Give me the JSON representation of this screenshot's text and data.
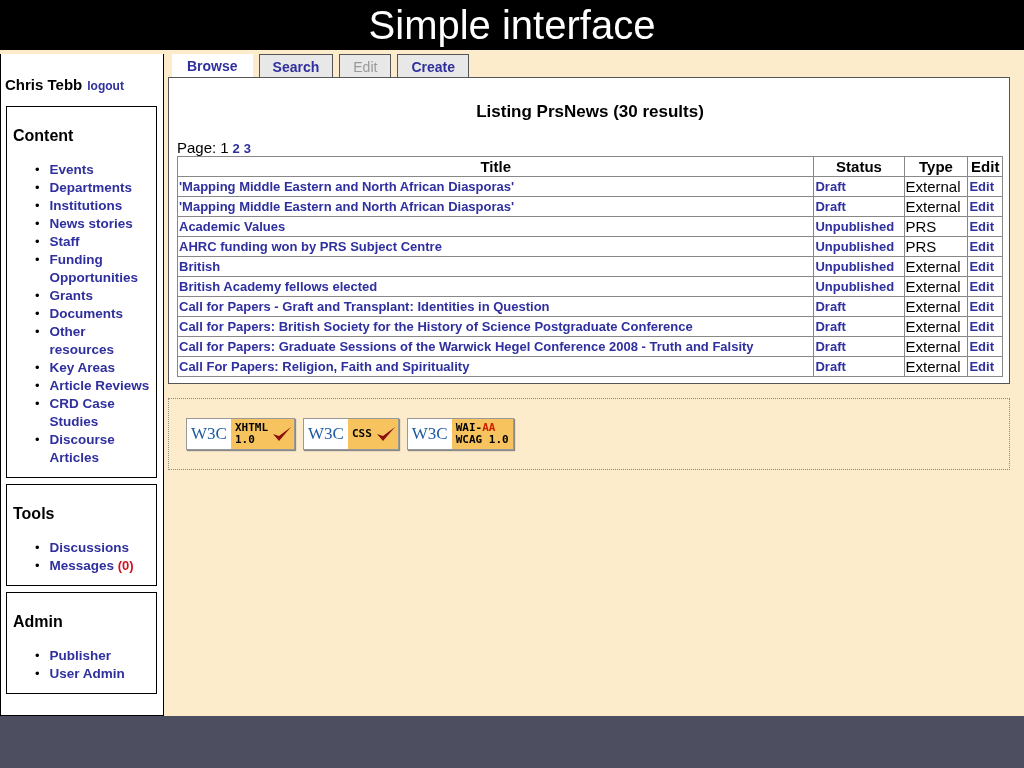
{
  "slide_title": "Simple interface",
  "user": {
    "name": "Chris Tebb",
    "logout": "logout"
  },
  "sidebar": [
    {
      "title": "Content",
      "items": [
        {
          "bullet": "•",
          "label": "Events"
        },
        {
          "bullet": "•",
          "label": "Departments"
        },
        {
          "bullet": "•",
          "label": "Institutions"
        },
        {
          "bullet": "•",
          "label": "News stories"
        },
        {
          "bullet": "•",
          "label": "Staff"
        },
        {
          "bullet": "•",
          "label": "Funding Opportunities"
        },
        {
          "bullet": "•",
          "label": "Grants"
        },
        {
          "bullet": "•",
          "label": "Documents"
        },
        {
          "bullet": "•",
          "label": "Other resources"
        },
        {
          "bullet": "•",
          "label": "Key Areas"
        },
        {
          "bullet": "•",
          "label": "Article Reviews"
        },
        {
          "bullet": "•",
          "label": "CRD Case Studies"
        },
        {
          "bullet": "•",
          "label": "Discourse Articles"
        }
      ]
    },
    {
      "title": "Tools",
      "items": [
        {
          "bullet": "•",
          "label": "Discussions"
        },
        {
          "bullet": "•",
          "label": "Messages",
          "count": "(0)"
        }
      ]
    },
    {
      "title": "Admin",
      "items": [
        {
          "bullet": "•",
          "label": "Publisher"
        },
        {
          "bullet": "•",
          "label": "User Admin"
        }
      ]
    }
  ],
  "tabs": [
    {
      "label": "Browse",
      "selected": true,
      "disabled": false
    },
    {
      "label": "Search",
      "selected": false,
      "disabled": false
    },
    {
      "label": "Edit",
      "selected": false,
      "disabled": true
    },
    {
      "label": "Create",
      "selected": false,
      "disabled": false
    }
  ],
  "heading": "Listing PrsNews (30 results)",
  "pager": {
    "label": "Page:",
    "pages": [
      {
        "label": "1",
        "selected": true
      },
      {
        "label": "2",
        "selected": false
      },
      {
        "label": "3",
        "selected": false
      }
    ]
  },
  "table": {
    "columns": [
      "Title",
      "Status",
      "Type",
      "Edit"
    ],
    "rows": [
      {
        "title": "'Mapping Middle Eastern and North African Diasporas'",
        "status": "Draft",
        "type": "External",
        "edit": "Edit"
      },
      {
        "title": "'Mapping Middle Eastern and North African Diasporas'",
        "status": "Draft",
        "type": "External",
        "edit": "Edit"
      },
      {
        "title": "Academic Values",
        "status": "Unpublished",
        "type": "PRS",
        "edit": "Edit"
      },
      {
        "title": "AHRC funding won by PRS Subject Centre",
        "status": "Unpublished",
        "type": "PRS",
        "edit": "Edit"
      },
      {
        "title": "British",
        "status": "Unpublished",
        "type": "External",
        "edit": "Edit"
      },
      {
        "title": "British Academy fellows elected",
        "status": "Unpublished",
        "type": "External",
        "edit": "Edit"
      },
      {
        "title": "Call for Papers - Graft and Transplant: Identities in Question",
        "status": "Draft",
        "type": "External",
        "edit": "Edit"
      },
      {
        "title": "Call for Papers: British Society for the History of Science Postgraduate Conference",
        "status": "Draft",
        "type": "External",
        "edit": "Edit"
      },
      {
        "title": "Call for Papers: Graduate Sessions of the Warwick Hegel Conference 2008 - Truth and Falsity",
        "status": "Draft",
        "type": "External",
        "edit": "Edit"
      },
      {
        "title": "Call For Papers: Religion, Faith and Spirituality",
        "status": "Draft",
        "type": "External",
        "edit": "Edit"
      }
    ]
  },
  "badges": [
    {
      "logo": "W3C",
      "line1": "XHTML",
      "line2": "1.0",
      "check": true
    },
    {
      "logo": "W3C",
      "line1": "CSS",
      "check": true
    },
    {
      "logo": "W3C",
      "line1": "WAI-",
      "line1_accent": "AA",
      "line2": "WCAG 1.0",
      "check": false
    }
  ]
}
